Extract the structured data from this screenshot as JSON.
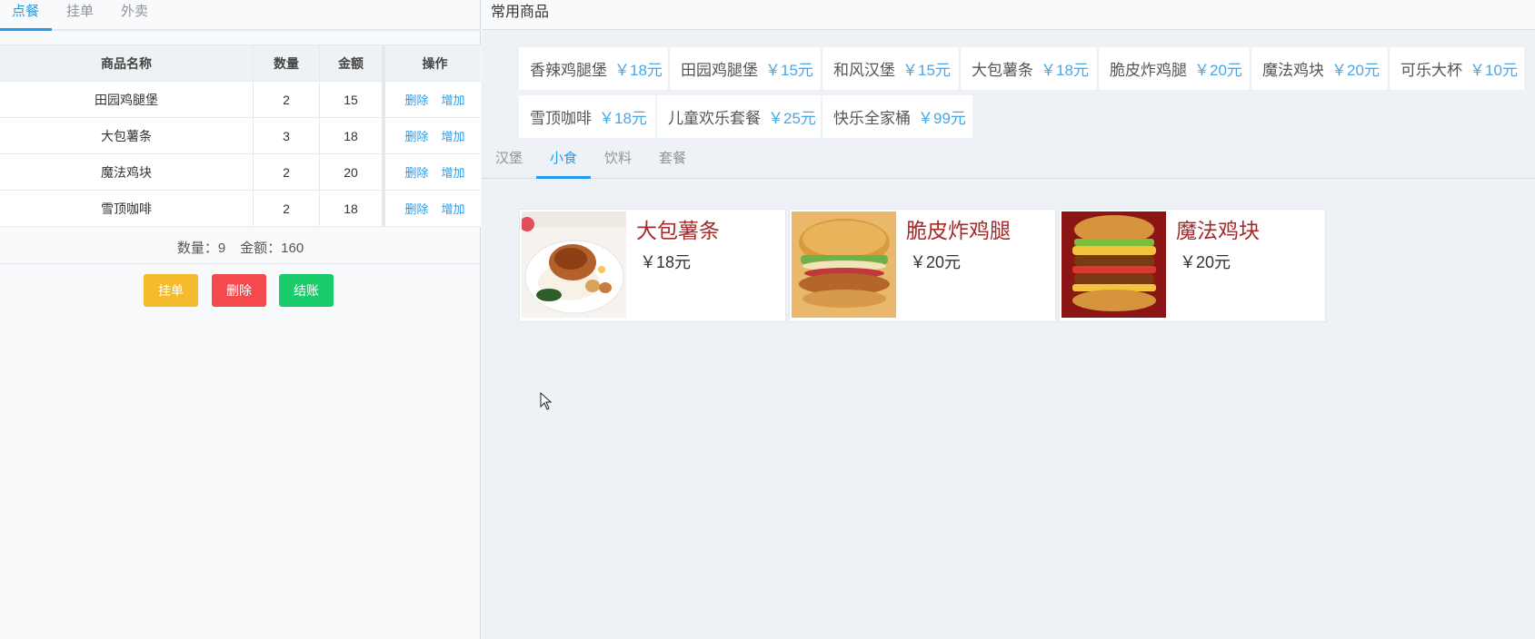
{
  "order_tabs": [
    {
      "label": "点餐",
      "active": true
    },
    {
      "label": "挂单",
      "active": false
    },
    {
      "label": "外卖",
      "active": false
    }
  ],
  "order_table": {
    "headers": {
      "name": "商品名称",
      "qty": "数量",
      "amount": "金额",
      "ops": "操作"
    },
    "rows": [
      {
        "name": "田园鸡腿堡",
        "qty": "2",
        "amount": "15",
        "del": "删除",
        "add": "增加"
      },
      {
        "name": "大包薯条",
        "qty": "3",
        "amount": "18",
        "del": "删除",
        "add": "增加"
      },
      {
        "name": "魔法鸡块",
        "qty": "2",
        "amount": "20",
        "del": "删除",
        "add": "增加"
      },
      {
        "name": "雪顶咖啡",
        "qty": "2",
        "amount": "18",
        "del": "删除",
        "add": "增加"
      }
    ]
  },
  "summary": {
    "qty_text": "数量：9",
    "amount_text": "金额：160"
  },
  "actions": {
    "hang": "挂单",
    "delete": "删除",
    "checkout": "结账"
  },
  "favorites": {
    "title": "常用商品",
    "items": [
      {
        "name": "香辣鸡腿堡",
        "price": "￥18元"
      },
      {
        "name": "田园鸡腿堡",
        "price": "￥15元"
      },
      {
        "name": "和风汉堡",
        "price": "￥15元"
      },
      {
        "name": "大包薯条",
        "price": "￥18元"
      },
      {
        "name": "脆皮炸鸡腿",
        "price": "￥20元"
      },
      {
        "name": "魔法鸡块",
        "price": "￥20元"
      },
      {
        "name": "可乐大杯",
        "price": "￥10元"
      },
      {
        "name": "雪顶咖啡",
        "price": "￥18元"
      },
      {
        "name": "儿童欢乐套餐",
        "price": "￥25元"
      },
      {
        "name": "快乐全家桶",
        "price": "￥99元"
      }
    ]
  },
  "category_tabs": [
    {
      "label": "汉堡",
      "active": false
    },
    {
      "label": "小食",
      "active": true
    },
    {
      "label": "饮料",
      "active": false
    },
    {
      "label": "套餐",
      "active": false
    }
  ],
  "products": [
    {
      "name": "大包薯条",
      "price": "￥18元",
      "image": "rice-chicken-plate"
    },
    {
      "name": "脆皮炸鸡腿",
      "price": "￥20元",
      "image": "crispy-chicken-burger"
    },
    {
      "name": "魔法鸡块",
      "price": "￥20元",
      "image": "double-burger"
    }
  ],
  "colors": {
    "accent": "#1f9cf0",
    "warning": "#f6bb2c",
    "danger": "#f44a4e",
    "success": "#19cb69",
    "product_name": "#a52a2a",
    "price_blue": "#47a7e6"
  }
}
